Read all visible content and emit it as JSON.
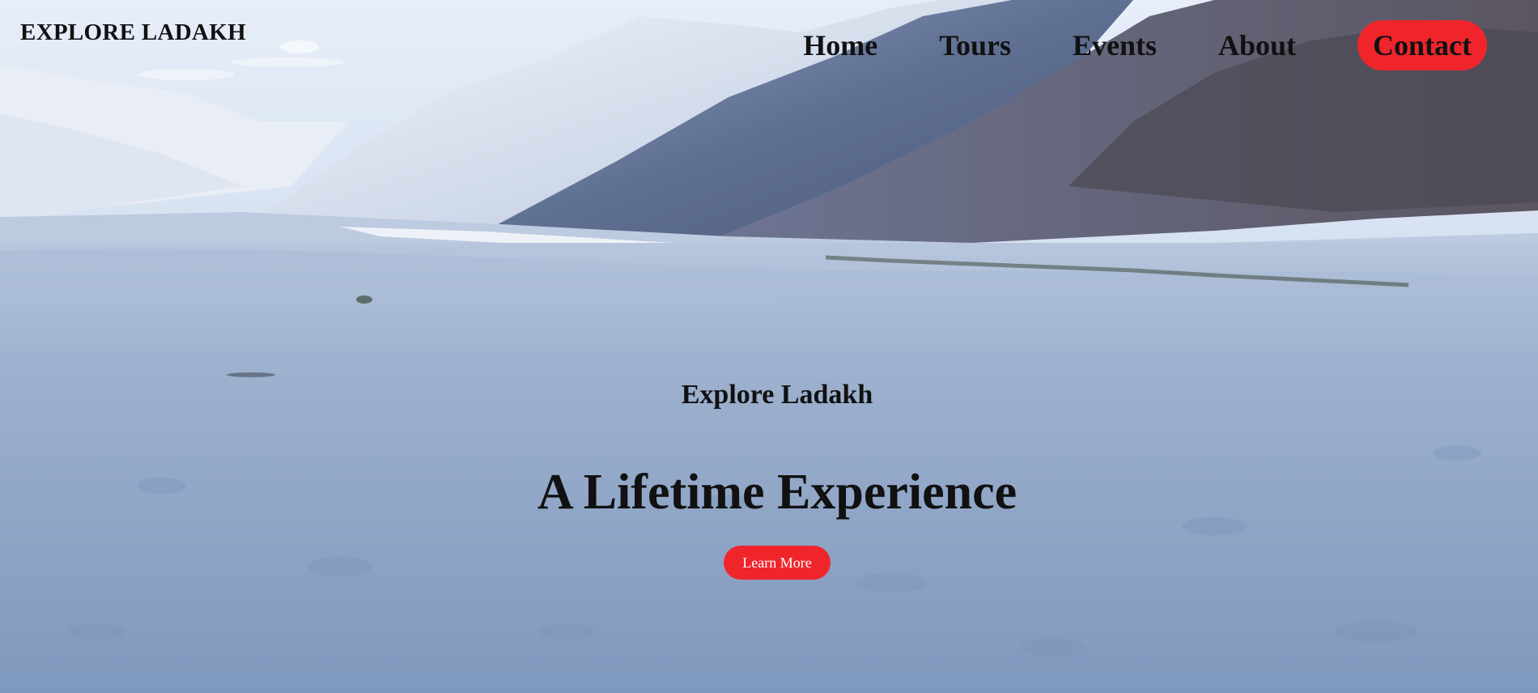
{
  "brand": {
    "logo_text": "EXPLORE LADAKH"
  },
  "nav": {
    "items": [
      {
        "label": "Home"
      },
      {
        "label": "Tours"
      },
      {
        "label": "Events"
      },
      {
        "label": "About"
      },
      {
        "label": "Contact"
      }
    ]
  },
  "hero": {
    "subtitle": "Explore Ladakh",
    "headline": "A Lifetime Experience",
    "cta_label": "Learn More",
    "background_image": "mountain-valley-sand-dunes"
  },
  "colors": {
    "accent": "#f0252c",
    "text": "#111111",
    "cta_text": "#ffffff"
  }
}
